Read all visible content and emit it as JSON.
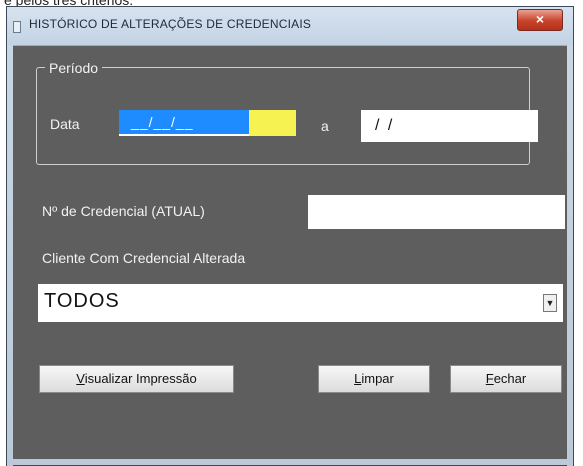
{
  "caption": "e pelos três critérios.",
  "window": {
    "title": "HISTÓRICO DE ALTERAÇÕES DE CREDENCIAIS",
    "close_label": "×"
  },
  "periodo": {
    "legend": "Período",
    "data_label": "Data",
    "start_value": "__/__/__",
    "separator_label": "a",
    "end_value": "/ /"
  },
  "credencial": {
    "label": "Nº de Credencial (ATUAL)",
    "value": ""
  },
  "cliente": {
    "label": "Cliente Com Credencial Alterada",
    "selected": "TODOS"
  },
  "buttons": {
    "visualizar_first": "V",
    "visualizar_rest": "isualizar Impressão",
    "limpar_first": "L",
    "limpar_rest": "impar",
    "fechar_first": "F",
    "fechar_rest": "echar"
  }
}
